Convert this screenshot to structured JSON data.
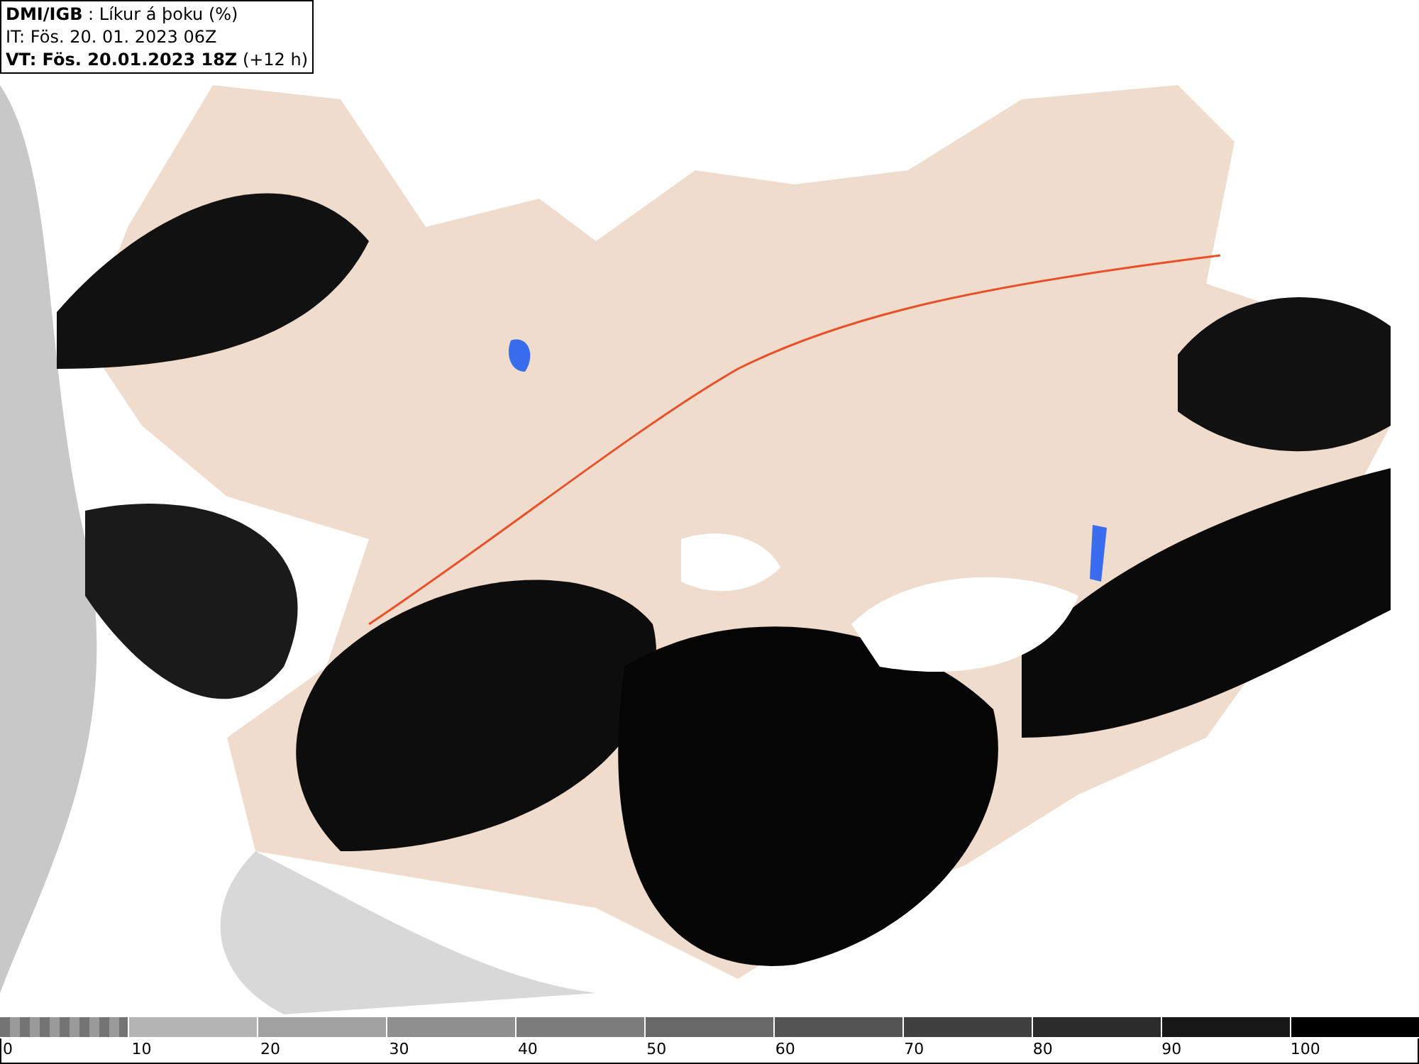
{
  "header": {
    "lines": [
      "**DMI/IGB** : Líkur á þoku (%)",
      "IT: Fös. 20. 01. 2023 06Z",
      "**VT: Fös. 20.01.2023 18Z** (+12 h)"
    ]
  },
  "legend": {
    "segments": [
      {
        "kind": "checker",
        "color": "#9a9a9a"
      },
      {
        "kind": "solid",
        "color": "#b4b4b4"
      },
      {
        "kind": "solid",
        "color": "#a2a2a2"
      },
      {
        "kind": "solid",
        "color": "#8f8f8f"
      },
      {
        "kind": "solid",
        "color": "#7c7c7c"
      },
      {
        "kind": "solid",
        "color": "#686868"
      },
      {
        "kind": "solid",
        "color": "#545454"
      },
      {
        "kind": "solid",
        "color": "#404040"
      },
      {
        "kind": "solid",
        "color": "#2c2c2c"
      },
      {
        "kind": "solid",
        "color": "#181818"
      },
      {
        "kind": "solid",
        "color": "#000000"
      }
    ],
    "labels": [
      "0",
      "10",
      "20",
      "30",
      "40",
      "50",
      "60",
      "70",
      "80",
      "90",
      "100"
    ]
  }
}
